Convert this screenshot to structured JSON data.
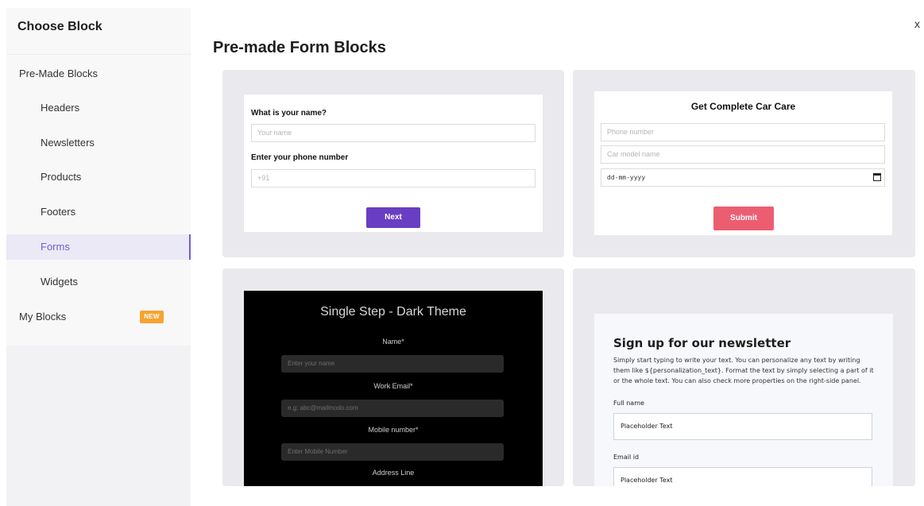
{
  "sidebar": {
    "title": "Choose Block",
    "section_premade": "Pre-Made Blocks",
    "items": [
      {
        "label": "Headers"
      },
      {
        "label": "Newsletters"
      },
      {
        "label": "Products"
      },
      {
        "label": "Footers"
      },
      {
        "label": "Forms",
        "active": true
      },
      {
        "label": "Widgets"
      }
    ],
    "section_myblocks": "My Blocks",
    "new_badge": "NEW"
  },
  "close_label": "x",
  "main": {
    "title": "Pre-made Form Blocks",
    "card1": {
      "q1_label": "What is your name?",
      "q1_placeholder": "Your name",
      "q2_label": "Enter your phone number",
      "q2_placeholder": "+91",
      "button": "Next"
    },
    "card2": {
      "title": "Get Complete Car Care",
      "phone_placeholder": "Phone number",
      "car_placeholder": "Car model name",
      "date_placeholder": "dd-mm-yyyy",
      "button": "Submit"
    },
    "card3": {
      "title": "Single Step - Dark Theme",
      "name_label": "Name*",
      "name_placeholder": "Enter your name",
      "email_label": "Work Email*",
      "email_placeholder": "e.g: abc@mailmodo.com",
      "mobile_label": "Mobile number*",
      "mobile_placeholder": "Enter Mobile Number",
      "address_label": "Address Line"
    },
    "card4": {
      "title": "Sign up for our newsletter",
      "body": "Simply start typing to write your text. You can personalize any text by writing them like ${personalization_text}. Format the text by simply selecting a part of it or the whole text. You can also check more properties on the right-side panel.",
      "fullname_label": "Full name",
      "fullname_value": "Placeholder Text",
      "email_label": "Email id",
      "email_value": "Placeholder Text"
    }
  },
  "colors": {
    "accent": "#6e5fd0",
    "next_button": "#6a3ec2",
    "submit_button": "#ec5d72",
    "badge": "#f7a332"
  }
}
